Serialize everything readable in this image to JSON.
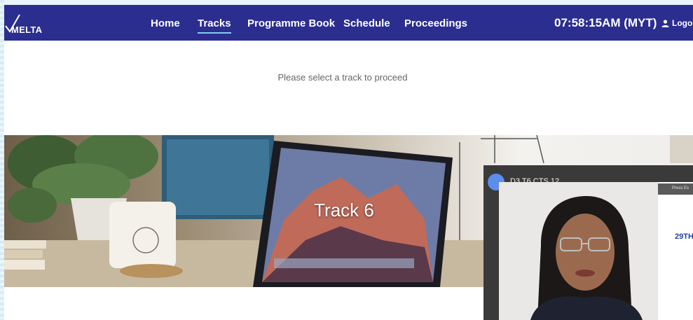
{
  "navbar": {
    "logo_text": "MELTA",
    "links": [
      {
        "label": "Home"
      },
      {
        "label": "Tracks"
      },
      {
        "label": "Programme Book"
      },
      {
        "label": "Schedule"
      },
      {
        "label": "Proceedings"
      }
    ],
    "active_link": "Tracks",
    "clock": "07:58:15AM (MYT)",
    "logout_label": "Logo",
    "background": "#2b2d8f"
  },
  "main": {
    "prompt": "Please select a track to proceed"
  },
  "banner": {
    "title": "Track 6"
  },
  "video_overlay": {
    "participant_label": "D3 T6 CTS 12",
    "press_hint": "Press Es",
    "side_text": "29TH"
  }
}
